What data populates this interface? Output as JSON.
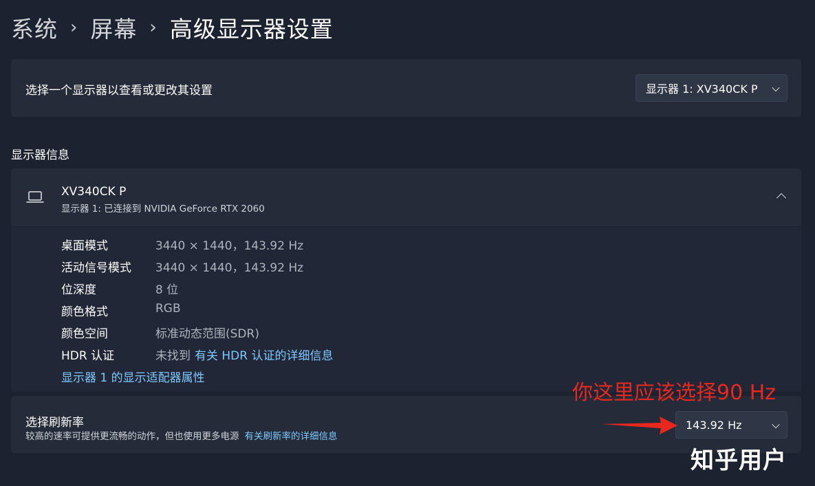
{
  "breadcrumb": [
    "系统",
    "屏幕",
    "高级显示器设置"
  ],
  "monitor_select": {
    "label": "选择一个显示器以查看或更改其设置",
    "selected": "显示器 1: XV340CK P"
  },
  "section_title": "显示器信息",
  "monitor": {
    "name": "XV340CK P",
    "subtitle": "显示器 1: 已连接到 NVIDIA GeForce RTX 2060",
    "details": [
      {
        "key": "桌面模式",
        "value": "3440 × 1440，143.92 Hz"
      },
      {
        "key": "活动信号模式",
        "value": "3440 × 1440，143.92 Hz"
      },
      {
        "key": "位深度",
        "value": "8 位"
      },
      {
        "key": "颜色格式",
        "value": "RGB"
      },
      {
        "key": "颜色空间",
        "value": "标准动态范围(SDR)"
      }
    ],
    "hdr": {
      "key": "HDR 认证",
      "value": "未找到",
      "link": "有关 HDR 认证的详细信息"
    },
    "adapter_link": "显示器 1 的显示适配器属性"
  },
  "refresh": {
    "title": "选择刷新率",
    "description": "较高的速率可提供更流畅的动作，但也使用更多电源",
    "link": "有关刷新率的详细信息",
    "selected": "143.92 Hz"
  },
  "annotation": "你这里应该选择90 Hz",
  "watermark": "知乎用户",
  "icons": {
    "monitor": "laptop-icon",
    "expand": "chevron-up-icon",
    "dropdown": "chevron-down-icon"
  },
  "colors": {
    "background": "#1c2230",
    "card": "#252b38",
    "link": "#7ec8ff",
    "annotation": "#e8281f"
  }
}
